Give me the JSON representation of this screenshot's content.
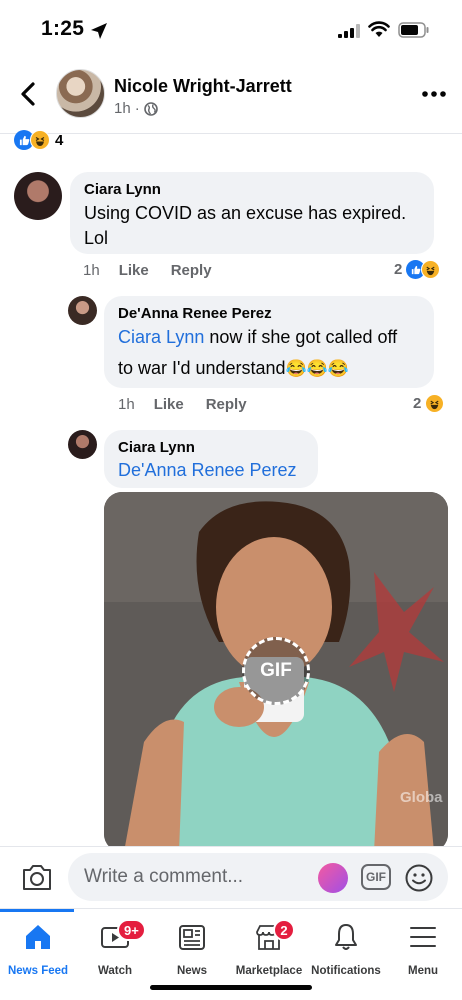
{
  "status_bar": {
    "time": "1:25"
  },
  "post_header": {
    "author_name": "Nicole Wright-Jarrett",
    "post_time": "1h",
    "separator": "·"
  },
  "reactions_summary": {
    "count": "4"
  },
  "comments": [
    {
      "author": "Ciara Lynn",
      "text_line1": "Using COVID as an excuse has expired.",
      "text_line2": "Lol",
      "time": "1h",
      "like_label": "Like",
      "reply_label": "Reply",
      "reaction_count": "2"
    },
    {
      "author": "De'Anna Renee Perez",
      "mention": "Ciara Lynn",
      "text_line1": " now if she got called off",
      "text_line2": "to war I'd understand",
      "emojis": "😂😂😂",
      "time": "1h",
      "like_label": "Like",
      "reply_label": "Reply",
      "reaction_count": "2"
    },
    {
      "author": "Ciara Lynn",
      "mention": "De'Anna Renee Perez",
      "gif_label": "GIF",
      "gif_watermark": "Globa"
    }
  ],
  "composer": {
    "placeholder": "Write a comment...",
    "gif_button_label": "GIF"
  },
  "tab_bar": {
    "tabs": [
      {
        "label": "News Feed",
        "icon": "home-icon",
        "active": true
      },
      {
        "label": "Watch",
        "icon": "watch-icon",
        "badge": "9+"
      },
      {
        "label": "News",
        "icon": "news-icon"
      },
      {
        "label": "Marketplace",
        "icon": "marketplace-icon",
        "badge": "2"
      },
      {
        "label": "Notifications",
        "icon": "bell-icon"
      },
      {
        "label": "Menu",
        "icon": "menu-icon"
      }
    ]
  },
  "colors": {
    "brand_blue": "#1877f2",
    "mention_blue": "#216fdb",
    "bubble_gray": "#f0f2f5",
    "badge_red": "#e41e3f",
    "haha_yellow": "#f7b125"
  }
}
